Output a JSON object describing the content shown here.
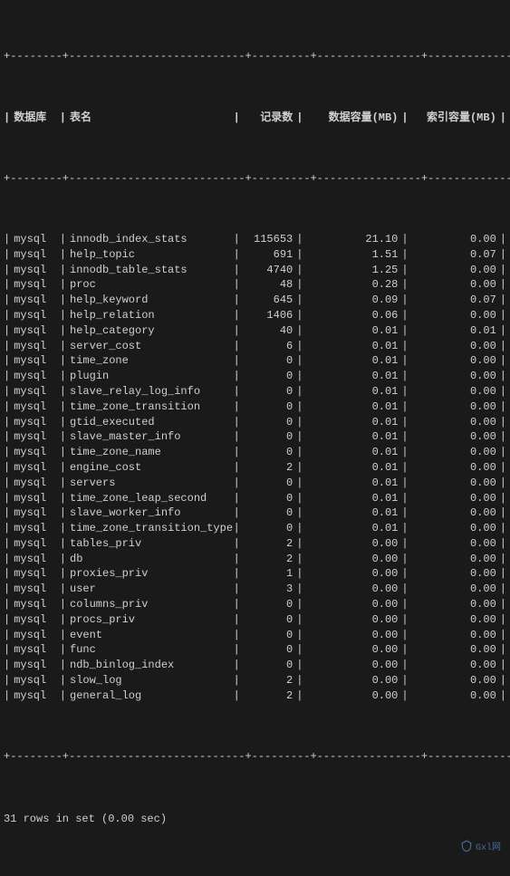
{
  "headers": {
    "db": "数据库",
    "table": "表名",
    "records": "记录数",
    "data_mb": "数据容量(MB)",
    "index_mb": "索引容量(MB)"
  },
  "rows": [
    {
      "db": "mysql",
      "table": "innodb_index_stats",
      "records": "115653",
      "data_mb": "21.10",
      "index_mb": "0.00"
    },
    {
      "db": "mysql",
      "table": "help_topic",
      "records": "691",
      "data_mb": "1.51",
      "index_mb": "0.07"
    },
    {
      "db": "mysql",
      "table": "innodb_table_stats",
      "records": "4740",
      "data_mb": "1.25",
      "index_mb": "0.00"
    },
    {
      "db": "mysql",
      "table": "proc",
      "records": "48",
      "data_mb": "0.28",
      "index_mb": "0.00"
    },
    {
      "db": "mysql",
      "table": "help_keyword",
      "records": "645",
      "data_mb": "0.09",
      "index_mb": "0.07"
    },
    {
      "db": "mysql",
      "table": "help_relation",
      "records": "1406",
      "data_mb": "0.06",
      "index_mb": "0.00"
    },
    {
      "db": "mysql",
      "table": "help_category",
      "records": "40",
      "data_mb": "0.01",
      "index_mb": "0.01"
    },
    {
      "db": "mysql",
      "table": "server_cost",
      "records": "6",
      "data_mb": "0.01",
      "index_mb": "0.00"
    },
    {
      "db": "mysql",
      "table": "time_zone",
      "records": "0",
      "data_mb": "0.01",
      "index_mb": "0.00"
    },
    {
      "db": "mysql",
      "table": "plugin",
      "records": "0",
      "data_mb": "0.01",
      "index_mb": "0.00"
    },
    {
      "db": "mysql",
      "table": "slave_relay_log_info",
      "records": "0",
      "data_mb": "0.01",
      "index_mb": "0.00"
    },
    {
      "db": "mysql",
      "table": "time_zone_transition",
      "records": "0",
      "data_mb": "0.01",
      "index_mb": "0.00"
    },
    {
      "db": "mysql",
      "table": "gtid_executed",
      "records": "0",
      "data_mb": "0.01",
      "index_mb": "0.00"
    },
    {
      "db": "mysql",
      "table": "slave_master_info",
      "records": "0",
      "data_mb": "0.01",
      "index_mb": "0.00"
    },
    {
      "db": "mysql",
      "table": "time_zone_name",
      "records": "0",
      "data_mb": "0.01",
      "index_mb": "0.00"
    },
    {
      "db": "mysql",
      "table": "engine_cost",
      "records": "2",
      "data_mb": "0.01",
      "index_mb": "0.00"
    },
    {
      "db": "mysql",
      "table": "servers",
      "records": "0",
      "data_mb": "0.01",
      "index_mb": "0.00"
    },
    {
      "db": "mysql",
      "table": "time_zone_leap_second",
      "records": "0",
      "data_mb": "0.01",
      "index_mb": "0.00"
    },
    {
      "db": "mysql",
      "table": "slave_worker_info",
      "records": "0",
      "data_mb": "0.01",
      "index_mb": "0.00"
    },
    {
      "db": "mysql",
      "table": "time_zone_transition_type",
      "records": "0",
      "data_mb": "0.01",
      "index_mb": "0.00"
    },
    {
      "db": "mysql",
      "table": "tables_priv",
      "records": "2",
      "data_mb": "0.00",
      "index_mb": "0.00"
    },
    {
      "db": "mysql",
      "table": "db",
      "records": "2",
      "data_mb": "0.00",
      "index_mb": "0.00"
    },
    {
      "db": "mysql",
      "table": "proxies_priv",
      "records": "1",
      "data_mb": "0.00",
      "index_mb": "0.00"
    },
    {
      "db": "mysql",
      "table": "user",
      "records": "3",
      "data_mb": "0.00",
      "index_mb": "0.00"
    },
    {
      "db": "mysql",
      "table": "columns_priv",
      "records": "0",
      "data_mb": "0.00",
      "index_mb": "0.00"
    },
    {
      "db": "mysql",
      "table": "procs_priv",
      "records": "0",
      "data_mb": "0.00",
      "index_mb": "0.00"
    },
    {
      "db": "mysql",
      "table": "event",
      "records": "0",
      "data_mb": "0.00",
      "index_mb": "0.00"
    },
    {
      "db": "mysql",
      "table": "func",
      "records": "0",
      "data_mb": "0.00",
      "index_mb": "0.00"
    },
    {
      "db": "mysql",
      "table": "ndb_binlog_index",
      "records": "0",
      "data_mb": "0.00",
      "index_mb": "0.00"
    },
    {
      "db": "mysql",
      "table": "slow_log",
      "records": "2",
      "data_mb": "0.00",
      "index_mb": "0.00"
    },
    {
      "db": "mysql",
      "table": "general_log",
      "records": "2",
      "data_mb": "0.00",
      "index_mb": "0.00"
    }
  ],
  "footer": "31 rows in set (0.00 sec)",
  "watermark": "Gxl网"
}
